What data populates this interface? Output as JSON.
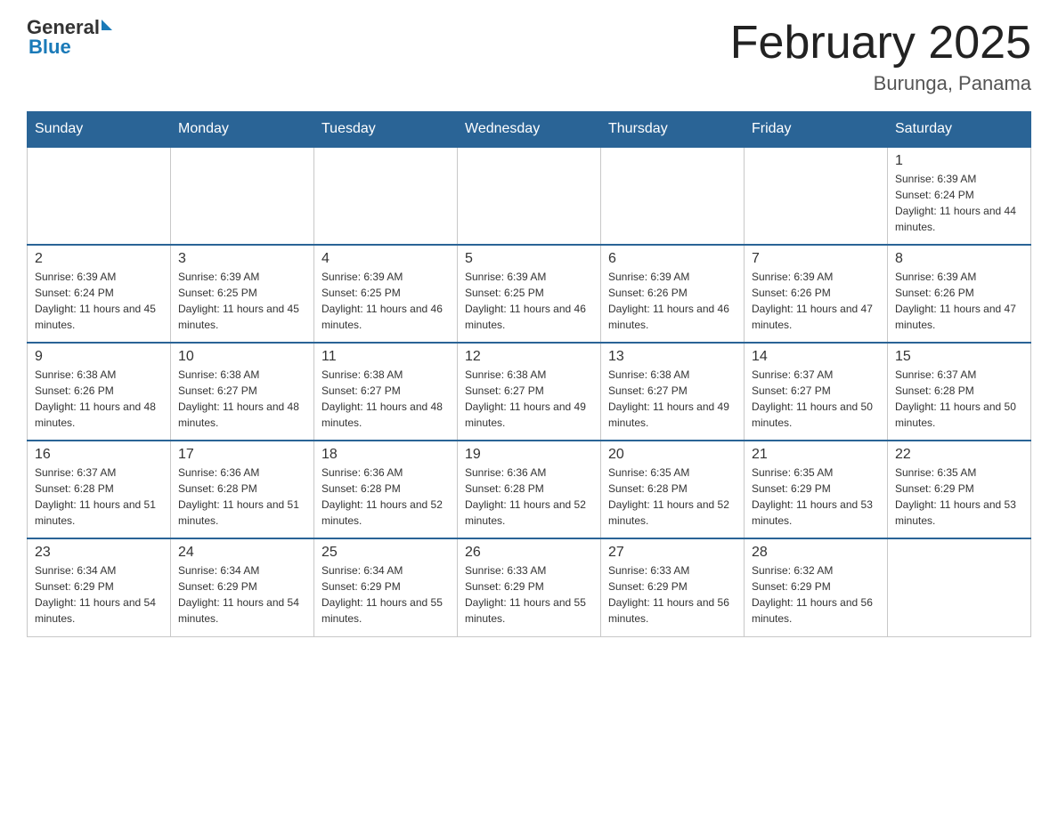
{
  "header": {
    "logo_line1": "General",
    "logo_line2": "Blue",
    "title": "February 2025",
    "subtitle": "Burunga, Panama"
  },
  "calendar": {
    "days_of_week": [
      "Sunday",
      "Monday",
      "Tuesday",
      "Wednesday",
      "Thursday",
      "Friday",
      "Saturday"
    ],
    "weeks": [
      [
        {
          "day": "",
          "info": "",
          "empty": true
        },
        {
          "day": "",
          "info": "",
          "empty": true
        },
        {
          "day": "",
          "info": "",
          "empty": true
        },
        {
          "day": "",
          "info": "",
          "empty": true
        },
        {
          "day": "",
          "info": "",
          "empty": true
        },
        {
          "day": "",
          "info": "",
          "empty": true
        },
        {
          "day": "1",
          "info": "Sunrise: 6:39 AM\nSunset: 6:24 PM\nDaylight: 11 hours and 44 minutes."
        }
      ],
      [
        {
          "day": "2",
          "info": "Sunrise: 6:39 AM\nSunset: 6:24 PM\nDaylight: 11 hours and 45 minutes."
        },
        {
          "day": "3",
          "info": "Sunrise: 6:39 AM\nSunset: 6:25 PM\nDaylight: 11 hours and 45 minutes."
        },
        {
          "day": "4",
          "info": "Sunrise: 6:39 AM\nSunset: 6:25 PM\nDaylight: 11 hours and 46 minutes."
        },
        {
          "day": "5",
          "info": "Sunrise: 6:39 AM\nSunset: 6:25 PM\nDaylight: 11 hours and 46 minutes."
        },
        {
          "day": "6",
          "info": "Sunrise: 6:39 AM\nSunset: 6:26 PM\nDaylight: 11 hours and 46 minutes."
        },
        {
          "day": "7",
          "info": "Sunrise: 6:39 AM\nSunset: 6:26 PM\nDaylight: 11 hours and 47 minutes."
        },
        {
          "day": "8",
          "info": "Sunrise: 6:39 AM\nSunset: 6:26 PM\nDaylight: 11 hours and 47 minutes."
        }
      ],
      [
        {
          "day": "9",
          "info": "Sunrise: 6:38 AM\nSunset: 6:26 PM\nDaylight: 11 hours and 48 minutes."
        },
        {
          "day": "10",
          "info": "Sunrise: 6:38 AM\nSunset: 6:27 PM\nDaylight: 11 hours and 48 minutes."
        },
        {
          "day": "11",
          "info": "Sunrise: 6:38 AM\nSunset: 6:27 PM\nDaylight: 11 hours and 48 minutes."
        },
        {
          "day": "12",
          "info": "Sunrise: 6:38 AM\nSunset: 6:27 PM\nDaylight: 11 hours and 49 minutes."
        },
        {
          "day": "13",
          "info": "Sunrise: 6:38 AM\nSunset: 6:27 PM\nDaylight: 11 hours and 49 minutes."
        },
        {
          "day": "14",
          "info": "Sunrise: 6:37 AM\nSunset: 6:27 PM\nDaylight: 11 hours and 50 minutes."
        },
        {
          "day": "15",
          "info": "Sunrise: 6:37 AM\nSunset: 6:28 PM\nDaylight: 11 hours and 50 minutes."
        }
      ],
      [
        {
          "day": "16",
          "info": "Sunrise: 6:37 AM\nSunset: 6:28 PM\nDaylight: 11 hours and 51 minutes."
        },
        {
          "day": "17",
          "info": "Sunrise: 6:36 AM\nSunset: 6:28 PM\nDaylight: 11 hours and 51 minutes."
        },
        {
          "day": "18",
          "info": "Sunrise: 6:36 AM\nSunset: 6:28 PM\nDaylight: 11 hours and 52 minutes."
        },
        {
          "day": "19",
          "info": "Sunrise: 6:36 AM\nSunset: 6:28 PM\nDaylight: 11 hours and 52 minutes."
        },
        {
          "day": "20",
          "info": "Sunrise: 6:35 AM\nSunset: 6:28 PM\nDaylight: 11 hours and 52 minutes."
        },
        {
          "day": "21",
          "info": "Sunrise: 6:35 AM\nSunset: 6:29 PM\nDaylight: 11 hours and 53 minutes."
        },
        {
          "day": "22",
          "info": "Sunrise: 6:35 AM\nSunset: 6:29 PM\nDaylight: 11 hours and 53 minutes."
        }
      ],
      [
        {
          "day": "23",
          "info": "Sunrise: 6:34 AM\nSunset: 6:29 PM\nDaylight: 11 hours and 54 minutes."
        },
        {
          "day": "24",
          "info": "Sunrise: 6:34 AM\nSunset: 6:29 PM\nDaylight: 11 hours and 54 minutes."
        },
        {
          "day": "25",
          "info": "Sunrise: 6:34 AM\nSunset: 6:29 PM\nDaylight: 11 hours and 55 minutes."
        },
        {
          "day": "26",
          "info": "Sunrise: 6:33 AM\nSunset: 6:29 PM\nDaylight: 11 hours and 55 minutes."
        },
        {
          "day": "27",
          "info": "Sunrise: 6:33 AM\nSunset: 6:29 PM\nDaylight: 11 hours and 56 minutes."
        },
        {
          "day": "28",
          "info": "Sunrise: 6:32 AM\nSunset: 6:29 PM\nDaylight: 11 hours and 56 minutes."
        },
        {
          "day": "",
          "info": "",
          "empty": true
        }
      ]
    ]
  }
}
